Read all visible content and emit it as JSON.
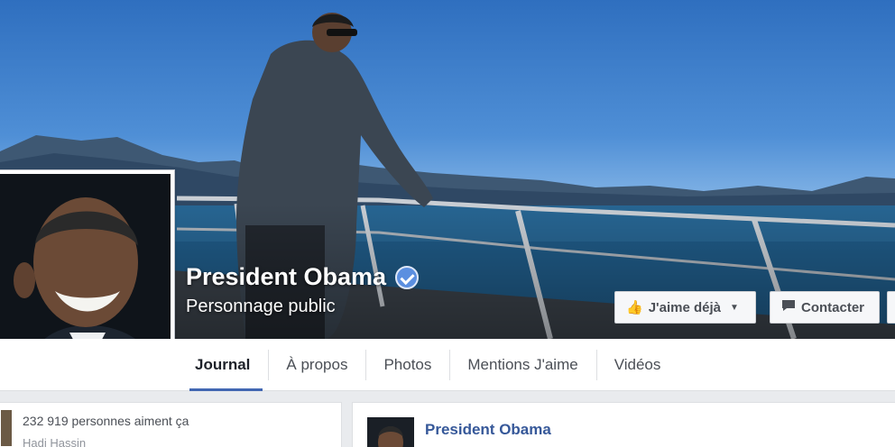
{
  "page": {
    "name": "President Obama",
    "category": "Personnage public"
  },
  "actions": {
    "like_label": "J'aime déjà",
    "contact_label": "Contacter"
  },
  "tabs": [
    {
      "label": "Journal",
      "active": true
    },
    {
      "label": "À propos",
      "active": false
    },
    {
      "label": "Photos",
      "active": false
    },
    {
      "label": "Mentions J'aime",
      "active": false
    },
    {
      "label": "Vidéos",
      "active": false
    }
  ],
  "sidebar": {
    "likes_text": "232 919 personnes aiment ça",
    "friend_name": "Hadi Hassin"
  },
  "post": {
    "author": "President Obama"
  },
  "colors": {
    "accent": "#4267b2",
    "link": "#365899",
    "verified": "#5b8fe0"
  },
  "icons": {
    "verified": "verified-badge-icon",
    "like": "thumbs-up-icon",
    "contact": "speech-bubble-icon",
    "caret": "chevron-down-icon"
  }
}
